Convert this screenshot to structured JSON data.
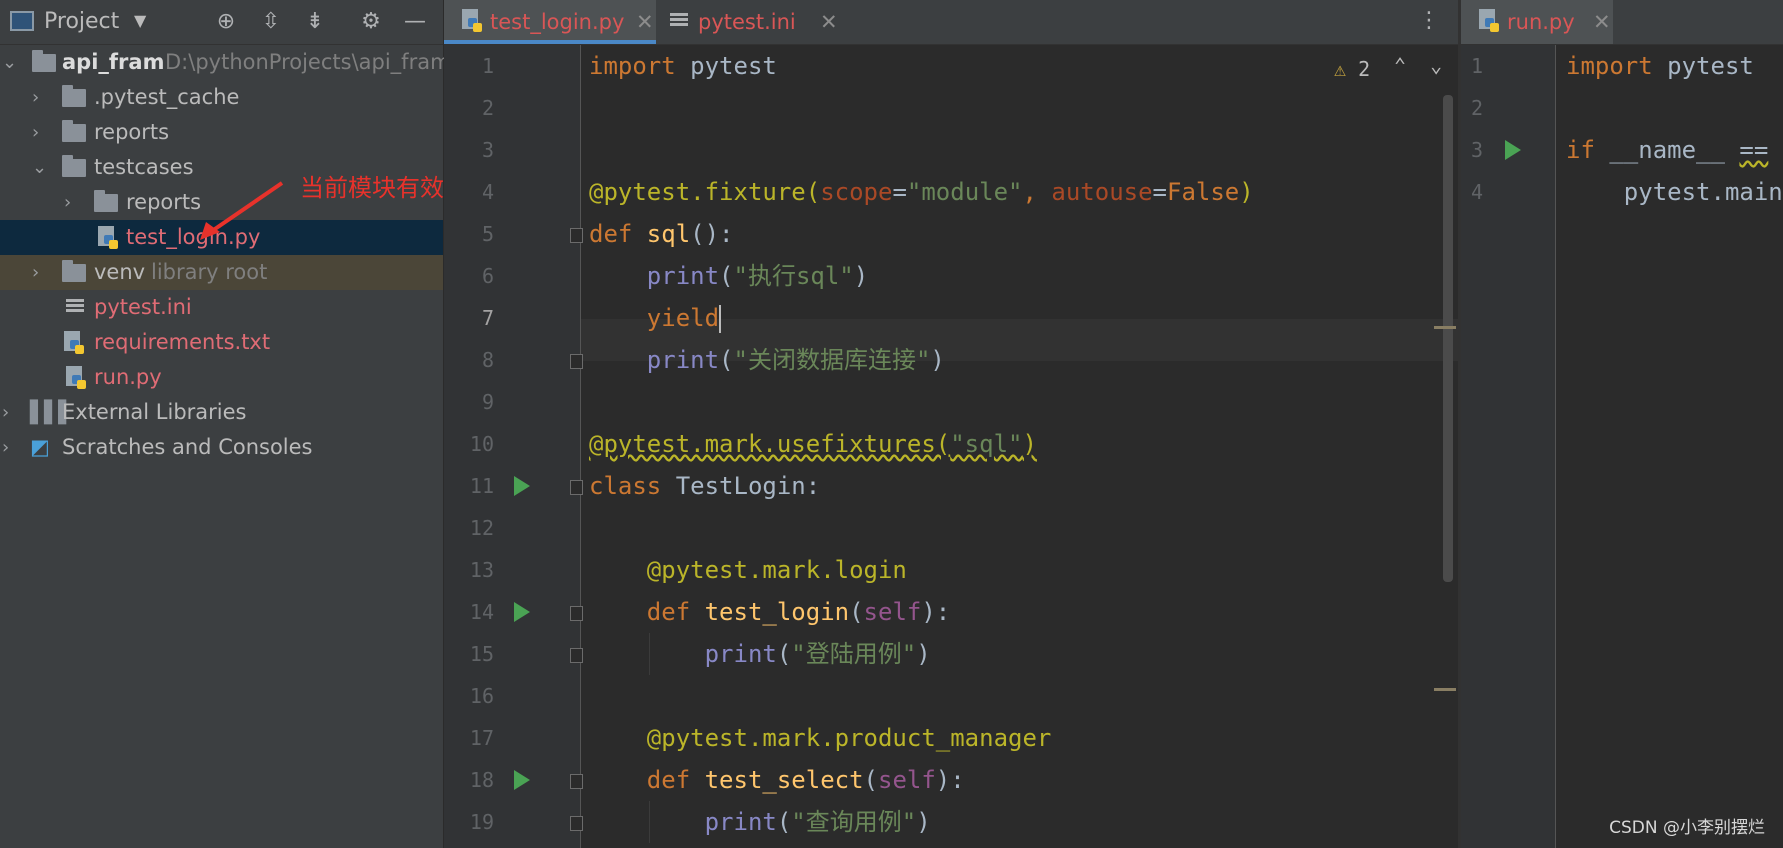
{
  "project_panel": {
    "title": "Project",
    "toolbar_icons": [
      "locate-icon",
      "expand-all-icon",
      "collapse-all-icon",
      "gear-icon",
      "minimize-icon"
    ],
    "tree": [
      {
        "label": "api_fram",
        "path": "D:\\pythonProjects\\api_fram",
        "type": "folder"
      },
      {
        "label": ".pytest_cache",
        "type": "folder"
      },
      {
        "label": "reports",
        "type": "folder"
      },
      {
        "label": "testcases",
        "type": "folder"
      },
      {
        "label": "reports",
        "type": "folder"
      },
      {
        "label": "test_login.py",
        "type": "python"
      },
      {
        "label": "venv",
        "suffix": "library root",
        "type": "folder"
      },
      {
        "label": "pytest.ini",
        "type": "ini"
      },
      {
        "label": "requirements.txt",
        "type": "text"
      },
      {
        "label": "run.py",
        "type": "python"
      },
      {
        "label": "External Libraries",
        "type": "library"
      },
      {
        "label": "Scratches and Consoles",
        "type": "scratch"
      }
    ]
  },
  "tabs": [
    {
      "label": "test_login.py",
      "active": true
    },
    {
      "label": "pytest.ini",
      "active": false
    },
    {
      "label": "run.py",
      "active": true
    }
  ],
  "editor_left": {
    "warnings": "2",
    "line_numbers": [
      "1",
      "2",
      "3",
      "4",
      "5",
      "6",
      "7",
      "8",
      "9",
      "10",
      "11",
      "12",
      "13",
      "14",
      "15",
      "16",
      "17",
      "18",
      "19"
    ],
    "lines": {
      "l1a": "import",
      "l1b": " pytest",
      "l4a": "@pytest.fixture(",
      "l4b": "scope",
      "l4c": "=",
      "l4d": "\"module\"",
      "l4e": ", ",
      "l4f": "autouse",
      "l4g": "=",
      "l4h": "False",
      "l4i": ")",
      "l5a": "def ",
      "l5b": "sql",
      "l5c": "():",
      "l6a": "    ",
      "l6b": "print",
      "l6c": "(",
      "l6d": "\"执行sql\"",
      "l6e": ")",
      "l7a": "    ",
      "l7b": "yield",
      "l8a": "    ",
      "l8b": "print",
      "l8c": "(",
      "l8d": "\"关闭数据库连接\"",
      "l8e": ")",
      "l10a": "@pytest.mark.usefixtures(",
      "l10b": "\"sql\"",
      "l10c": ")",
      "l11a": "class ",
      "l11b": "TestLogin:",
      "l13a": "    @pytest.mark.login",
      "l14a": "    def ",
      "l14b": "test_login",
      "l14c": "(",
      "l14d": "self",
      "l14e": "):",
      "l15a": "        ",
      "l15b": "print",
      "l15c": "(",
      "l15d": "\"登陆用例\"",
      "l15e": ")",
      "l17a": "    @pytest.mark.product_manager",
      "l18a": "    def ",
      "l18b": "test_select",
      "l18c": "(",
      "l18d": "self",
      "l18e": "):",
      "l19a": "        ",
      "l19b": "print",
      "l19c": "(",
      "l19d": "\"查询用例\"",
      "l19e": ")"
    }
  },
  "editor_right": {
    "line_numbers": [
      "1",
      "2",
      "3",
      "4"
    ],
    "lines": {
      "r1a": "import",
      "r1b": " pytest",
      "r3a": "if ",
      "r3b": "__name__",
      "r3c": " ",
      "r3d": "==",
      "r3e": " '_",
      "r4a": "    pytest.main"
    }
  },
  "annotation": "当前模块有效",
  "watermark": "CSDN @小李别摆烂",
  "colors": {
    "keyword": "#cc7832",
    "string": "#6a8759",
    "decorator": "#bbb529",
    "function": "#ffc66d",
    "annotation_red": "#e8322b"
  }
}
